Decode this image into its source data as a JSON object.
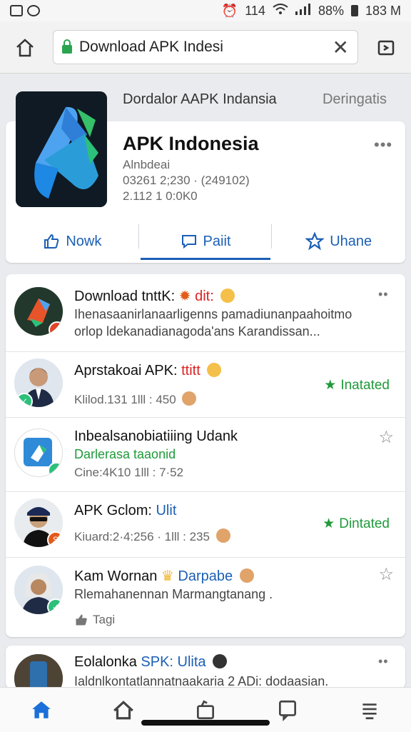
{
  "status_bar": {
    "left_icons": [
      "gallery-icon",
      "circle-icon"
    ],
    "signal_text": "114",
    "battery_text": "88%",
    "time": "183 M"
  },
  "browser": {
    "url_text": "Download APK Indesi",
    "clear_icon": "close-icon"
  },
  "hero": {
    "top_left": "Dordalor AAPK Indansia",
    "top_right": "Deringatis",
    "title": "APK Indonesia",
    "sub1": "Alnbdeai",
    "sub2": "03261 2;230 · (249102)",
    "sub3": "2.112 1 0:0K0",
    "actions": [
      {
        "label": "Nowk",
        "icon": "thumbs-up-icon"
      },
      {
        "label": "Paiit",
        "icon": "comment-icon"
      },
      {
        "label": "Uhane",
        "icon": "star-icon"
      }
    ]
  },
  "feed": [
    {
      "title": "Download tnttK:",
      "title_hl": "dit:",
      "sub": "Ihenasaanirlanaarligenns pamadiunanpaahoitmo",
      "sub2": "orlop ldekanadianagoda'ans Karandissan...",
      "meta": "",
      "action": ""
    },
    {
      "title": "Aprstakoai APK:",
      "title_hl": "ttitt",
      "sub": "",
      "meta": "Klilod.131  1lll : 450",
      "action": "Inatated"
    },
    {
      "title": "Inbealsanobiatiiing Udank",
      "title_hl": "",
      "sub": "Darlerasa  taaonid",
      "meta": "Cine:4K10  1lll : 7·52",
      "action": "star"
    },
    {
      "title": "APK Gclom:",
      "title_hl": "Ulit",
      "sub": "",
      "meta": "Kiuard:2·4:256 · 1lll : 235",
      "action": "Dintated"
    },
    {
      "title": "Kam Wornan",
      "title_hl": "Darpabe",
      "sub": "Rlemahanennan Marmangtanang .",
      "meta": "Tagi",
      "action": "star"
    }
  ],
  "last_item": {
    "title": "Eolalonka",
    "title_hl": "SPK: Ulita",
    "sub": "Ialdnlkontatlannatnaakaria 2 ADi: dodaasian."
  },
  "bottom_nav": [
    "home-icon",
    "house-outline-icon",
    "bag-icon",
    "chat-icon",
    "menu-icon"
  ],
  "colors": {
    "accent": "#1b5fb5",
    "green": "#1f9a3a",
    "red": "#d22222"
  }
}
